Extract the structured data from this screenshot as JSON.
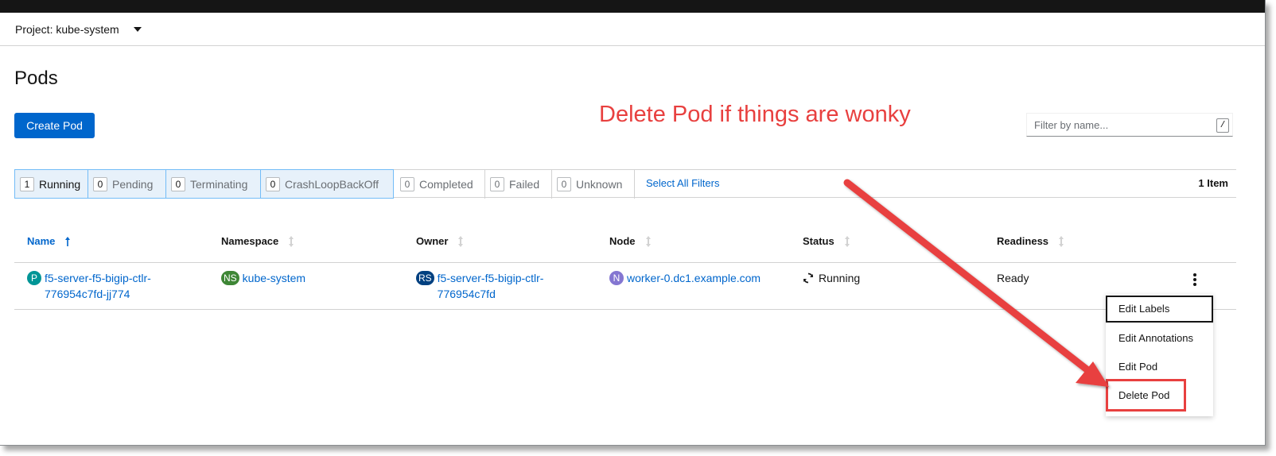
{
  "header": {
    "project_label": "Project: kube-system"
  },
  "page": {
    "title": "Pods",
    "create_button": "Create Pod",
    "annotation": "Delete Pod if things are wonky",
    "filter_placeholder": "Filter by name...",
    "filter_shortcut": "/"
  },
  "filters": {
    "chips": [
      {
        "count": "1",
        "label": "Running"
      },
      {
        "count": "0",
        "label": "Pending"
      },
      {
        "count": "0",
        "label": "Terminating"
      },
      {
        "count": "0",
        "label": "CrashLoopBackOff"
      },
      {
        "count": "0",
        "label": "Completed"
      },
      {
        "count": "0",
        "label": "Failed"
      },
      {
        "count": "0",
        "label": "Unknown"
      }
    ],
    "select_all": "Select All Filters",
    "item_count": "1 Item"
  },
  "table": {
    "columns": [
      "Name",
      "Namespace",
      "Owner",
      "Node",
      "Status",
      "Readiness"
    ],
    "row": {
      "name_badge": "P",
      "name_line1": "f5-server-f5-bigip-ctlr-",
      "name_line2": "776954c7fd-jj774",
      "namespace_badge": "NS",
      "namespace": "kube-system",
      "owner_badge": "RS",
      "owner_line1": "f5-server-f5-bigip-ctlr-",
      "owner_line2": "776954c7fd",
      "node_badge": "N",
      "node": "worker-0.dc1.example.com",
      "status": "Running",
      "readiness": "Ready"
    }
  },
  "menu": {
    "items": [
      "Edit Labels",
      "Edit Annotations",
      "Edit Pod",
      "Delete Pod"
    ]
  },
  "colors": {
    "primary": "#0066cc",
    "annotation": "#e8403f",
    "pod_badge": "#009596",
    "ns_badge": "#3e8635",
    "rs_badge": "#004080",
    "node_badge": "#8476d1"
  }
}
